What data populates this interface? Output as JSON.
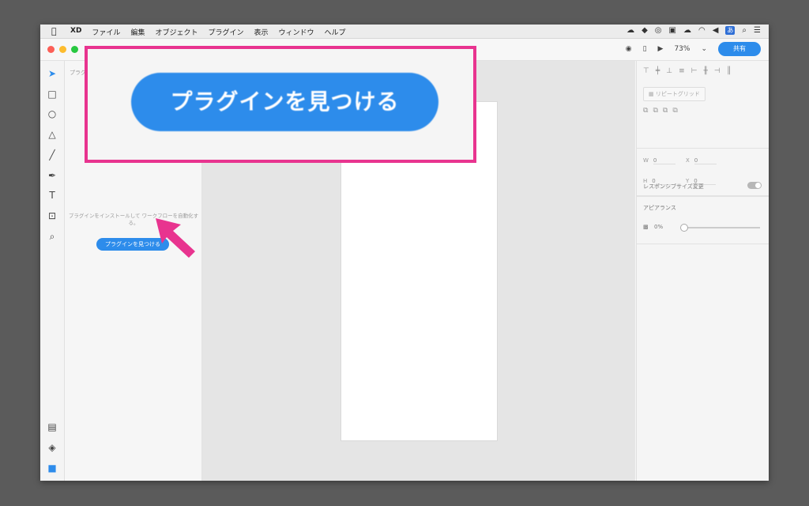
{
  "menubar": {
    "apple": "",
    "items": [
      "XD",
      "ファイル",
      "編集",
      "オブジェクト",
      "プラグイン",
      "表示",
      "ウィンドウ",
      "ヘルプ"
    ],
    "ime": "あ"
  },
  "toolbar": {
    "zoom": "73%",
    "share_label": "共有"
  },
  "plugins_panel": {
    "title": "プラグ",
    "description": "プラグインをインストールして ワークフローを自動化する。",
    "find_button": "プラグインを見つける"
  },
  "properties": {
    "repeat_grid": "リピートグリッド",
    "w_label": "W",
    "w_value": "0",
    "x_label": "X",
    "x_value": "0",
    "h_label": "H",
    "h_value": "0",
    "y_label": "Y",
    "y_value": "0",
    "responsive_resize": "レスポンシブサイズ変更",
    "appearance": "アピアランス",
    "opacity": "0%"
  },
  "callout": {
    "zoomed_button": "プラグインを見つける",
    "border_color": "#e8348f",
    "accent": "#2d8ceb"
  }
}
